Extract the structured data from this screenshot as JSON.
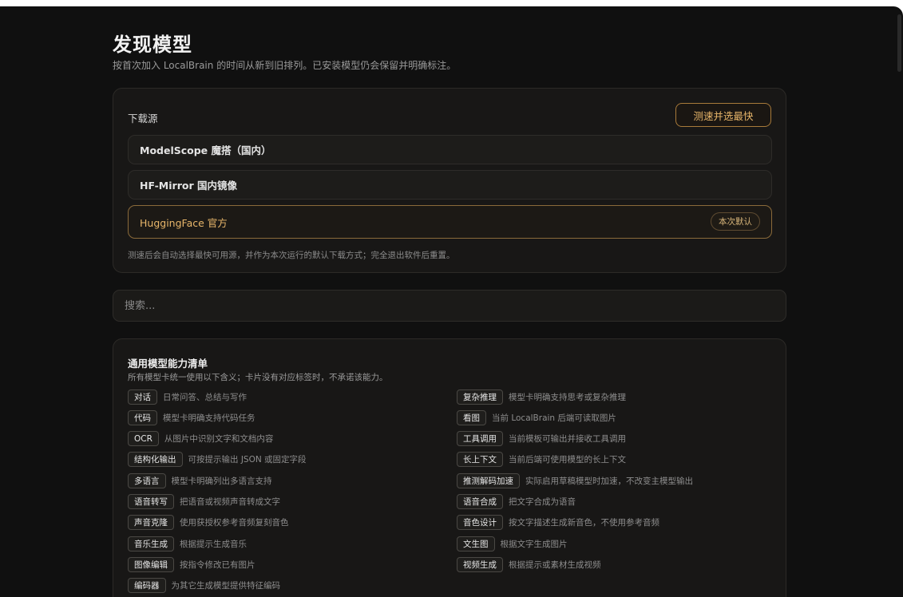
{
  "header": {
    "title": "发现模型",
    "subtitle": "按首次加入 LocalBrain 的时间从新到旧排列。已安装模型仍会保留并明确标注。"
  },
  "download": {
    "label": "下载源",
    "speed_button": "测速并选最快",
    "sources": [
      {
        "name": "ModelScope 魔搭（国内）"
      },
      {
        "name": "HF-Mirror 国内镜像"
      },
      {
        "name": "HuggingFace 官方",
        "badge": "本次默认"
      }
    ],
    "note": "测速后会自动选择最快可用源，并作为本次运行的默认下载方式；完全退出软件后重置。"
  },
  "search": {
    "placeholder": "搜索..."
  },
  "capabilities": {
    "title": "通用模型能力清单",
    "description": "所有模型卡统一使用以下含义；卡片没有对应标签时，不承诺该能力。",
    "items": [
      {
        "tag": "对话",
        "text": "日常问答、总结与写作"
      },
      {
        "tag": "复杂推理",
        "text": "模型卡明确支持思考或复杂推理"
      },
      {
        "tag": "代码",
        "text": "模型卡明确支持代码任务"
      },
      {
        "tag": "看图",
        "text": "当前 LocalBrain 后端可读取图片"
      },
      {
        "tag": "OCR",
        "text": "从图片中识别文字和文档内容"
      },
      {
        "tag": "工具调用",
        "text": "当前模板可输出并接收工具调用"
      },
      {
        "tag": "结构化输出",
        "text": "可按提示输出 JSON 或固定字段"
      },
      {
        "tag": "长上下文",
        "text": "当前后端可使用模型的长上下文"
      },
      {
        "tag": "多语言",
        "text": "模型卡明确列出多语言支持"
      },
      {
        "tag": "推测解码加速",
        "text": "实际启用草稿模型时加速，不改变主模型输出"
      },
      {
        "tag": "语音转写",
        "text": "把语音或视频声音转成文字"
      },
      {
        "tag": "语音合成",
        "text": "把文字合成为语音"
      },
      {
        "tag": "声音克隆",
        "text": "使用获授权参考音频复刻音色"
      },
      {
        "tag": "音色设计",
        "text": "按文字描述生成新音色，不使用参考音频"
      },
      {
        "tag": "音乐生成",
        "text": "根据提示生成音乐"
      },
      {
        "tag": "文生图",
        "text": "根据文字生成图片"
      },
      {
        "tag": "图像编辑",
        "text": "按指令修改已有图片"
      },
      {
        "tag": "视频生成",
        "text": "根据提示或素材生成视频"
      },
      {
        "tag": "编码器",
        "text": "为其它生成模型提供特征编码"
      }
    ]
  }
}
